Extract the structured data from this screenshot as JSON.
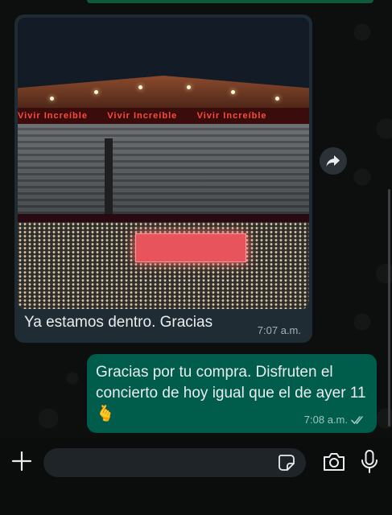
{
  "chat": {
    "incoming": {
      "caption": "Ya estamos dentro. Gracias",
      "time": "7:07 a.m.",
      "photo_led_text": "Vivir Increíble"
    },
    "outgoing": {
      "text": "Gracias por tu compra. Disfruten el concierto de hoy igual que el de ayer 11 🫰",
      "time": "7:08 a.m.",
      "status": "read"
    }
  },
  "input_bar": {
    "placeholder": ""
  },
  "icons": {
    "forward": "forward-arrow-icon",
    "add": "plus-icon",
    "sticker": "sticker-icon",
    "camera": "camera-icon",
    "mic": "microphone-icon",
    "read_receipt": "double-check-icon"
  },
  "colors": {
    "incoming_bubble": "#202c33",
    "outgoing_bubble": "#005c4b",
    "background": "#0b0d0c",
    "read_check": "#9dc7bd"
  }
}
